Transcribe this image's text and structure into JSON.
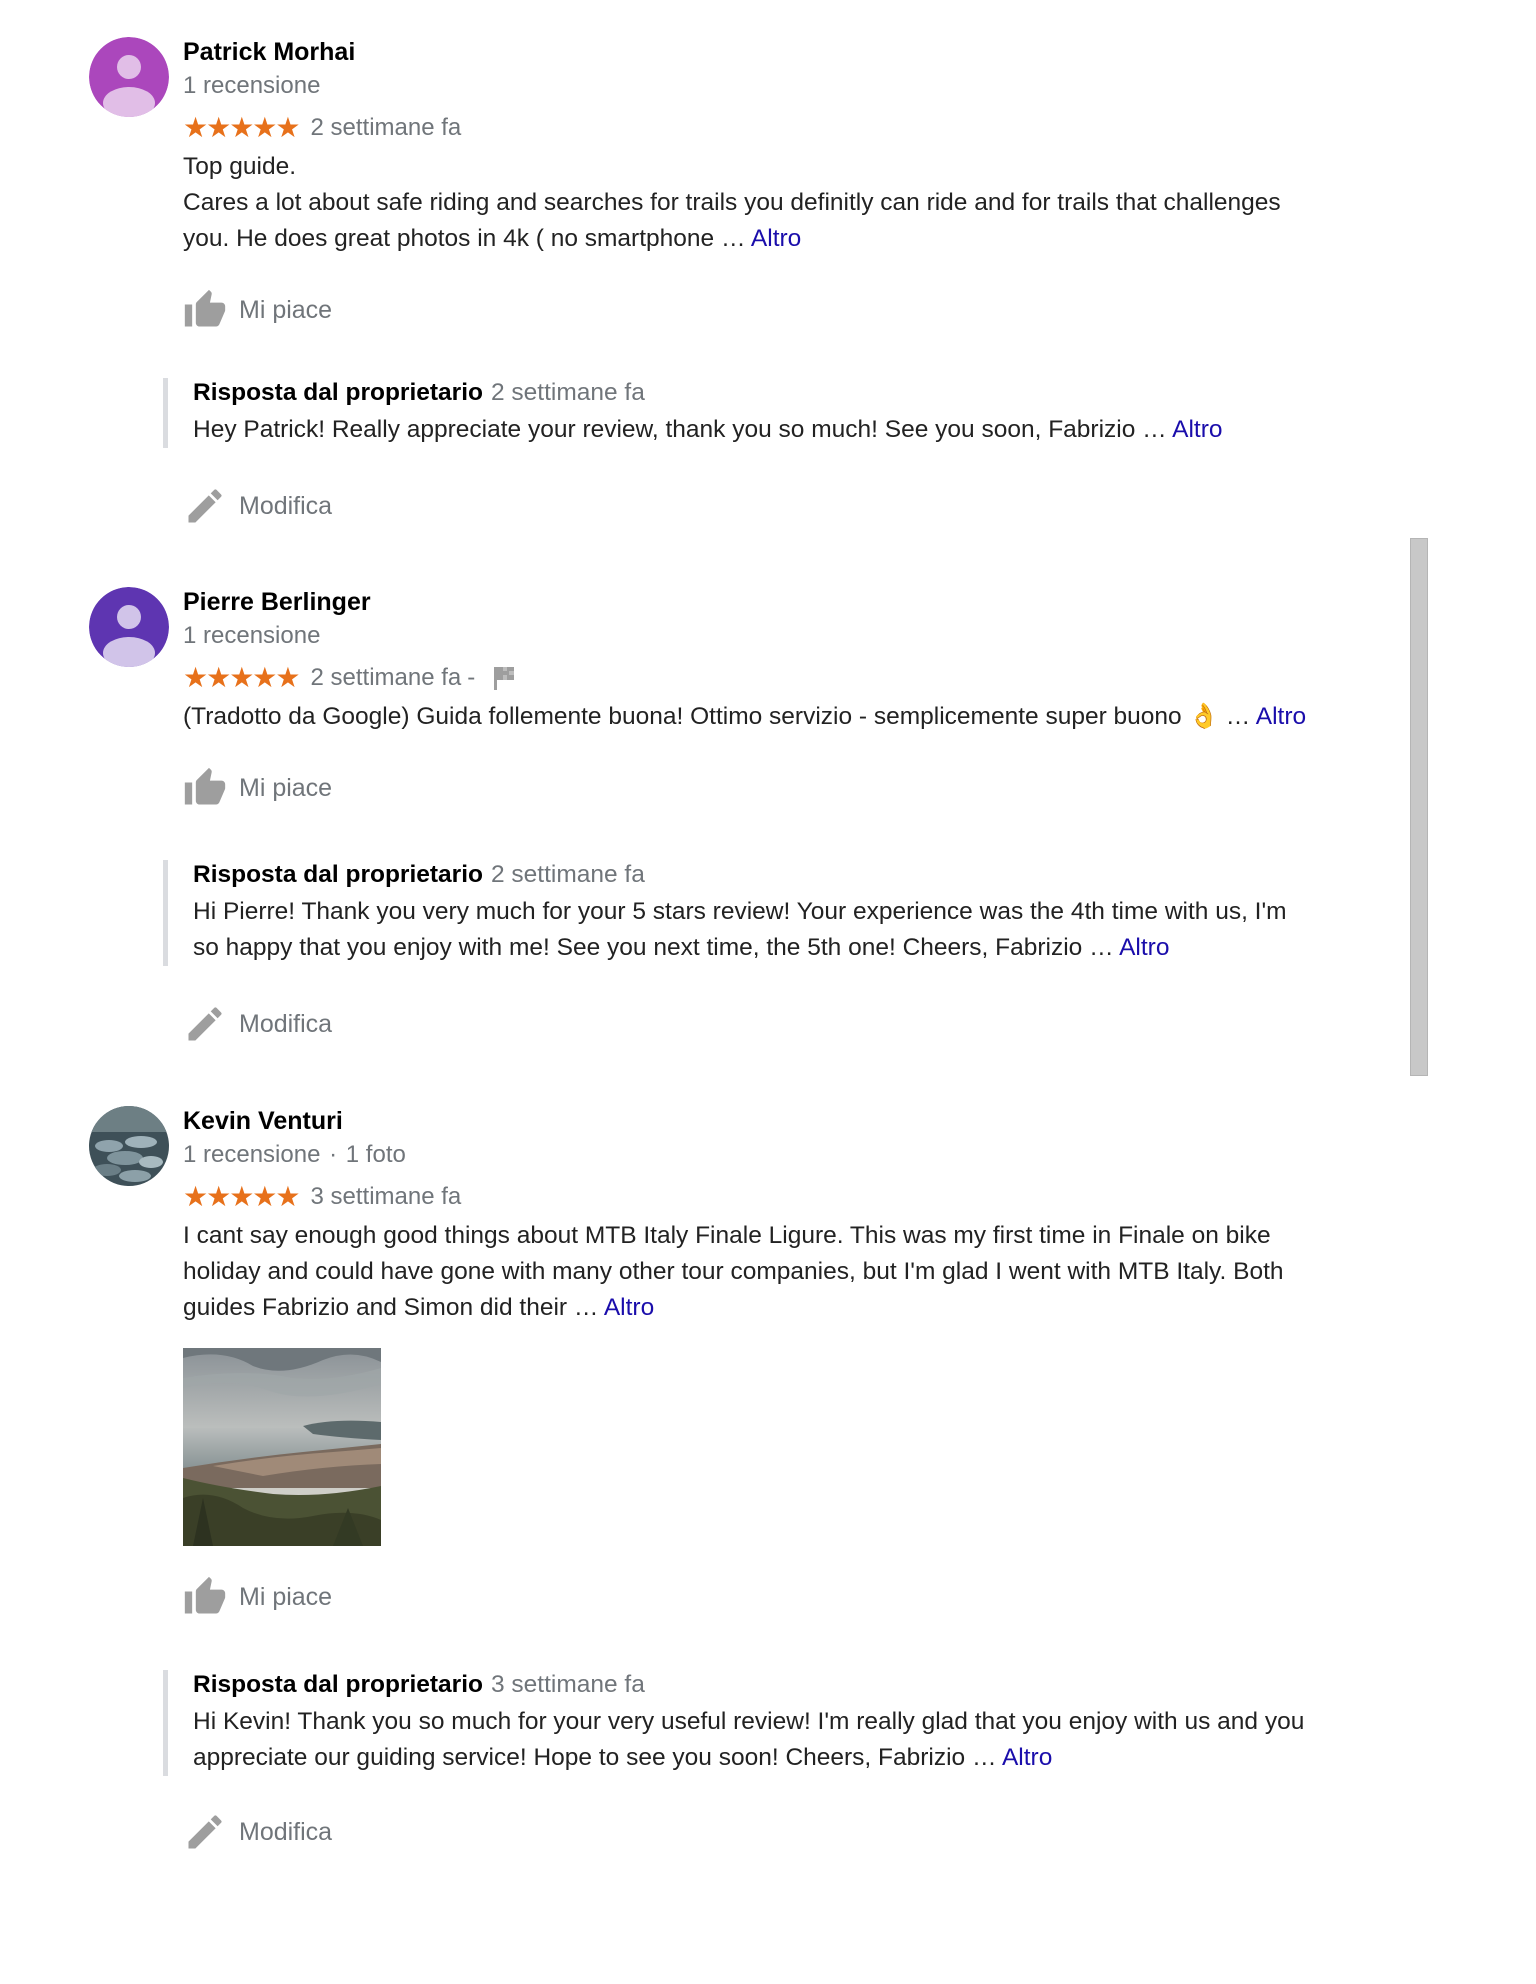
{
  "reviews": [
    {
      "name": "Patrick Morhai",
      "meta": "1 recensione",
      "stars": "★★★★★",
      "date": "2 settimane fa",
      "text_lines": [
        "Top guide.",
        "Cares a lot about safe riding and searches for trails you definitly can ride and for trails that challenges",
        "you. He does great photos in 4k ( no smartphone … "
      ],
      "more": "Altro",
      "like": "Mi piace",
      "reply": {
        "title": "Risposta dal proprietario",
        "date": "2 settimane fa",
        "lines": [
          "Hey Patrick! Really appreciate your review, thank you so much! See you soon, Fabrizio … "
        ],
        "more": "Altro"
      },
      "edit": "Modifica",
      "avatar_color": "#ab47bc"
    },
    {
      "name": "Pierre Berlinger",
      "meta": "1 recensione",
      "stars": "★★★★★",
      "date": "2 settimane fa",
      "dash": "-",
      "text_lines": [
        "(Tradotto da Google) Guida follemente buona! Ottimo servizio - semplicemente super buono 👌 … "
      ],
      "more": "Altro",
      "like": "Mi piace",
      "reply": {
        "title": "Risposta dal proprietario",
        "date": "2 settimane fa",
        "lines": [
          "Hi Pierre! Thank you very much for your 5 stars review! Your experience was the 4th time with us, I'm",
          "so happy that you enjoy with me! See you next time, the 5th one! Cheers, Fabrizio … "
        ],
        "more": "Altro"
      },
      "edit": "Modifica",
      "avatar_color": "#5e35b1"
    },
    {
      "name": "Kevin Venturi",
      "meta_reviews": "1 recensione",
      "meta_sep": "·",
      "meta_photos": "1 foto",
      "stars": "★★★★★",
      "date": "3 settimane fa",
      "text_lines": [
        "I cant say enough good things about MTB Italy Finale Ligure.  This was my first time in Finale on bike",
        "holiday and could have gone with many other tour companies, but I'm glad I went with MTB Italy.  Both",
        "guides Fabrizio and Simon did their … "
      ],
      "more": "Altro",
      "like": "Mi piace",
      "reply": {
        "title": "Risposta dal proprietario",
        "date": "3 settimane fa",
        "lines": [
          "Hi Kevin! Thank you so much for your very useful review! I'm really glad that you enjoy with us and you",
          "appreciate our guiding service! Hope to see you soon! Cheers, Fabrizio … "
        ],
        "more": "Altro"
      },
      "edit": "Modifica"
    }
  ],
  "icons": {
    "thumb": "thumbs-up-icon",
    "pencil": "pencil-icon",
    "flag": "flag-icon",
    "avatar": "person-icon"
  },
  "colors": {
    "star": "#e7711b",
    "link": "#1a0dab",
    "muted": "#70757a"
  }
}
